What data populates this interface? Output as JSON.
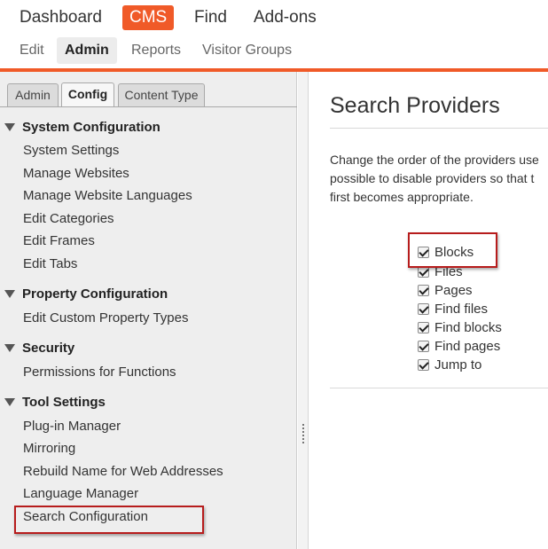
{
  "top_nav": [
    "Dashboard",
    "CMS",
    "Find",
    "Add-ons"
  ],
  "sub_nav": [
    "Edit",
    "Admin",
    "Reports",
    "Visitor Groups"
  ],
  "left_tabs": [
    "Admin",
    "Config",
    "Content Type"
  ],
  "tree": {
    "system": {
      "title": "System Configuration",
      "items": [
        "System Settings",
        "Manage Websites",
        "Manage Website Languages",
        "Edit Categories",
        "Edit Frames",
        "Edit Tabs"
      ]
    },
    "property": {
      "title": "Property Configuration",
      "items": [
        "Edit Custom Property Types"
      ]
    },
    "security": {
      "title": "Security",
      "items": [
        "Permissions for Functions"
      ]
    },
    "tools": {
      "title": "Tool Settings",
      "items": [
        "Plug-in Manager",
        "Mirroring",
        "Rebuild Name for Web Addresses",
        "Language Manager",
        "Search Configuration"
      ]
    }
  },
  "main": {
    "title": "Search Providers",
    "description_lines": [
      "Change the order of the providers use",
      "possible to disable providers so that t",
      "first becomes appropriate."
    ],
    "providers": [
      "Blocks",
      "Files",
      "Pages",
      "Find files",
      "Find blocks",
      "Find pages",
      "Jump to"
    ]
  },
  "colors": {
    "accent": "#f05a28",
    "highlight_border": "#b71c1c",
    "panel_bg": "#eeeeee"
  }
}
